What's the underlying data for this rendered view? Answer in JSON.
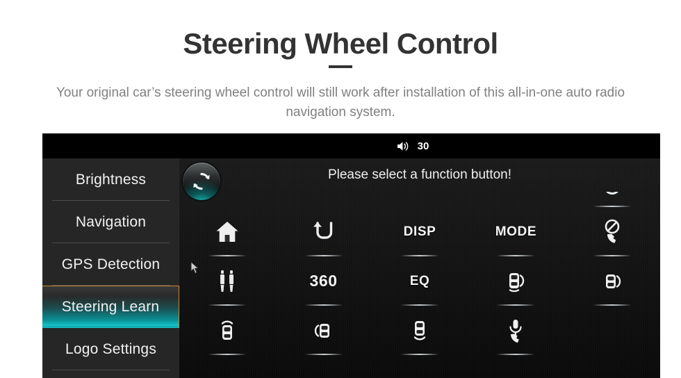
{
  "hero": {
    "title": "Steering Wheel Control",
    "subtitle": "Your original car’s steering wheel control will still work after installation of this all-in-one auto radio navigation system."
  },
  "device": {
    "statusbar": {
      "volume_icon": "speaker-volume-icon",
      "volume_value": "30"
    },
    "sidebar": {
      "items": [
        {
          "label": "Brightness",
          "selected": false
        },
        {
          "label": "Navigation",
          "selected": false
        },
        {
          "label": "GPS Detection",
          "selected": false
        },
        {
          "label": "Steering Learn",
          "selected": true
        },
        {
          "label": "Logo Settings",
          "selected": false
        }
      ]
    },
    "main": {
      "reset_icon": "refresh-circular-arrows-icon",
      "prompt": "Please select a function button!",
      "cursor_icon": "mouse-pointer-icon",
      "grid": {
        "rows": [
          {
            "partial": true,
            "cells": [
              {
                "type": "empty",
                "icon": "",
                "label": ""
              },
              {
                "type": "empty",
                "icon": "",
                "label": ""
              },
              {
                "type": "empty",
                "icon": "",
                "label": ""
              },
              {
                "type": "empty",
                "icon": "",
                "label": ""
              },
              {
                "type": "icon",
                "icon": "steering-wheel-partial-icon",
                "label": ""
              }
            ]
          },
          {
            "partial": false,
            "cells": [
              {
                "type": "icon",
                "icon": "home-icon",
                "label": ""
              },
              {
                "type": "icon",
                "icon": "back-return-arrow-icon",
                "label": ""
              },
              {
                "type": "text",
                "icon": "",
                "label": "DISP"
              },
              {
                "type": "text",
                "icon": "",
                "label": "MODE"
              },
              {
                "type": "icon",
                "icon": "hang-up-call-icon",
                "label": ""
              }
            ]
          },
          {
            "partial": false,
            "cells": [
              {
                "type": "icon",
                "icon": "aux-dual-plug-icon",
                "label": ""
              },
              {
                "type": "text",
                "icon": "",
                "label": "360"
              },
              {
                "type": "text",
                "icon": "",
                "label": "EQ"
              },
              {
                "type": "icon",
                "icon": "car-right-sensor-icon",
                "label": ""
              },
              {
                "type": "icon",
                "icon": "car-right-sensor-alt-icon",
                "label": ""
              }
            ]
          },
          {
            "partial": false,
            "cells": [
              {
                "type": "icon",
                "icon": "car-front-sensor-icon",
                "label": ""
              },
              {
                "type": "icon",
                "icon": "car-left-sensor-icon",
                "label": ""
              },
              {
                "type": "icon",
                "icon": "car-rear-sensor-icon",
                "label": ""
              },
              {
                "type": "icon",
                "icon": "microphone-call-icon",
                "label": ""
              },
              {
                "type": "empty",
                "icon": "",
                "label": ""
              }
            ]
          }
        ]
      }
    }
  },
  "colors": {
    "page_background": "#ffffff",
    "title_text": "#333333",
    "subtitle_text": "#808080",
    "device_black": "#000000",
    "sidebar_background": "#262626",
    "selected_accent_teal": "#14c3c8",
    "selected_border_gold": "#c98b33",
    "icon_white": "#f5f5f5"
  }
}
